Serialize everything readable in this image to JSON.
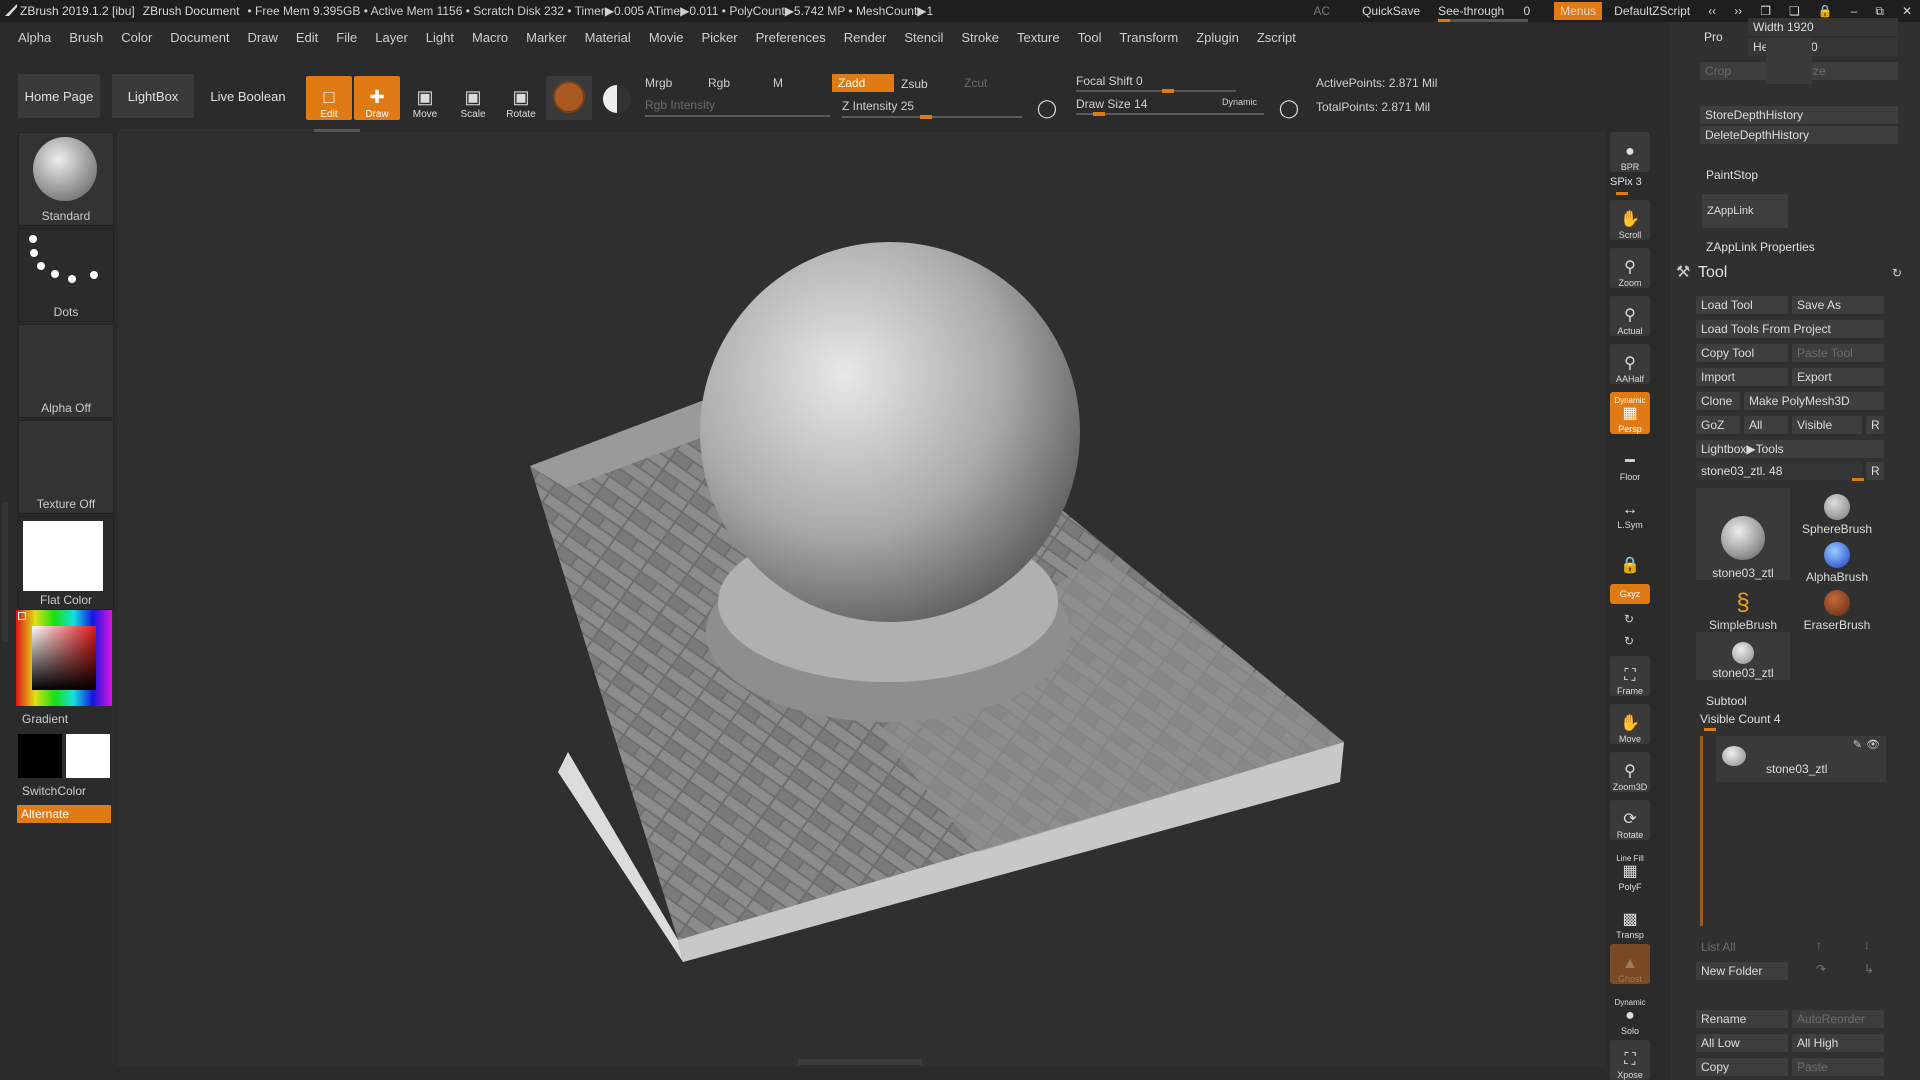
{
  "titlebar": {
    "app": "ZBrush 2019.1.2 [ibu]",
    "document": "ZBrush Document",
    "status": "• Free Mem 9.395GB • Active Mem 1156 • Scratch Disk 232 • Timer▶0.005 ATime▶0.011 • PolyCount▶5.742 MP • MeshCount▶1",
    "ac": "AC",
    "quicksave": "QuickSave",
    "seethrough": "See-through",
    "seethrough_value": "0",
    "menus": "Menus",
    "script": "DefaultZScript"
  },
  "menubar": [
    "Alpha",
    "Brush",
    "Color",
    "Document",
    "Draw",
    "Edit",
    "File",
    "Layer",
    "Light",
    "Macro",
    "Marker",
    "Material",
    "Movie",
    "Picker",
    "Preferences",
    "Render",
    "Stencil",
    "Stroke",
    "Texture",
    "Tool",
    "Transform",
    "Zplugin",
    "Zscript"
  ],
  "shelf": {
    "home": "Home Page",
    "lightbox": "LightBox",
    "live_boolean": "Live Boolean",
    "edit": "Edit",
    "draw": "Draw",
    "move": "Move",
    "scale": "Scale",
    "rotate": "Rotate",
    "mrgb": "Mrgb",
    "rgb": "Rgb",
    "m": "M",
    "zadd": "Zadd",
    "zsub": "Zsub",
    "zcut": "Zcut",
    "rgb_intensity": "Rgb Intensity",
    "z_intensity": "Z Intensity 25",
    "focal_shift": "Focal Shift 0",
    "draw_size": "Draw Size 14",
    "dynamic": "Dynamic",
    "active_points": "ActivePoints: 2.871 Mil",
    "total_points": "TotalPoints: 2.871 Mil"
  },
  "left": {
    "brush": "Standard",
    "stroke": "Dots",
    "alpha": "Alpha Off",
    "texture": "Texture Off",
    "material": "Flat Color",
    "gradient": "Gradient",
    "switchcolor": "SwitchColor",
    "alternate": "Alternate"
  },
  "dock": {
    "bpr": "BPR",
    "spix": "SPix 3",
    "scroll": "Scroll",
    "zoom": "Zoom",
    "actual": "Actual",
    "aahalf": "AAHalf",
    "persp_top": "Dynamic",
    "persp": "Persp",
    "floor": "Floor",
    "lsym": "L.Sym",
    "xyz": "Gxyz",
    "frame": "Frame",
    "move": "Move",
    "zoom3d": "Zoom3D",
    "rotate": "Rotate",
    "linefill": "Line Fill",
    "polyf": "PolyF",
    "transp": "Transp",
    "ghost": "Ghost",
    "solo_top": "Dynamic",
    "solo": "Solo",
    "xpose": "Xpose"
  },
  "tray": {
    "pro": "Pro",
    "width": "Width 1920",
    "height": "Height 1080",
    "crop": "Crop",
    "resize": "Resize",
    "store_depth": "StoreDepthHistory",
    "delete_depth": "DeleteDepthHistory",
    "paintstop": "PaintStop",
    "zapplink": "ZAppLink",
    "zapplink_props": "ZAppLink Properties",
    "tool_title": "Tool",
    "load_tool": "Load Tool",
    "save_as": "Save As",
    "load_from_project": "Load Tools From Project",
    "copy_tool": "Copy Tool",
    "paste_tool": "Paste Tool",
    "import": "Import",
    "export": "Export",
    "clone": "Clone",
    "make_polymesh": "Make PolyMesh3D",
    "goz": "GoZ",
    "all": "All",
    "visible": "Visible",
    "r": "R",
    "lightbox_tools": "Lightbox▶Tools",
    "current_tool": "stone03_ztl. 48",
    "thumbs": [
      "stone03_ztl",
      "SphereBrush",
      "AlphaBrush",
      "SimpleBrush",
      "EraserBrush",
      "stone03_ztl"
    ],
    "subtool": "Subtool",
    "visible_count": "Visible Count 4",
    "subtool_item": "stone03_ztl",
    "list_all": "List All",
    "new_folder": "New Folder",
    "rename": "Rename",
    "autoreorder": "AutoReorder",
    "all_low": "All Low",
    "all_high": "All High",
    "copy": "Copy",
    "paste": "Paste"
  }
}
